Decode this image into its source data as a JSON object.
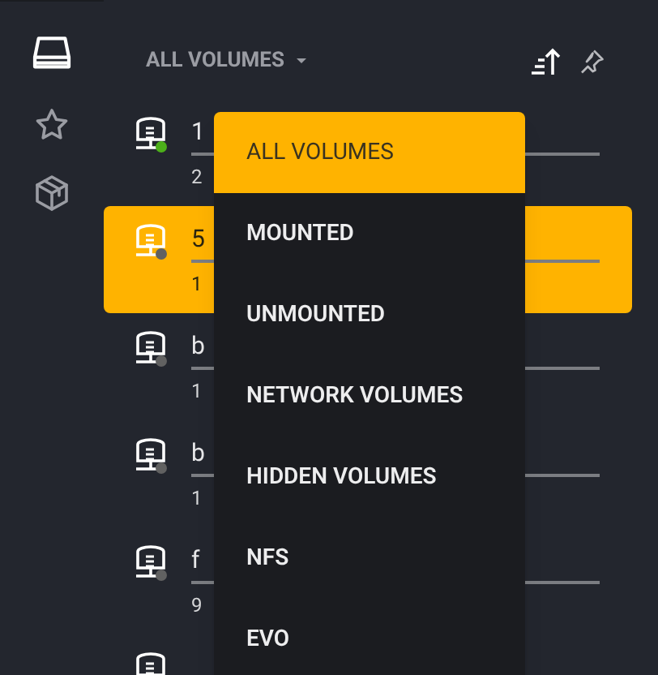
{
  "rail": [
    {
      "kind": "drive",
      "selected": true
    },
    {
      "kind": "star",
      "selected": false
    },
    {
      "kind": "box",
      "selected": false
    }
  ],
  "filter": {
    "label": "ALL VOLUMES"
  },
  "volumes": [
    {
      "name": "1",
      "detail": "2",
      "color": "#4caf1a",
      "selected": false
    },
    {
      "name": "5",
      "detail": "1",
      "color": "#616161",
      "selected": true
    },
    {
      "name": "b",
      "detail": "1",
      "color": "#616161",
      "selected": false
    },
    {
      "name": "b",
      "detail": "1",
      "color": "#616161",
      "selected": false
    },
    {
      "name": "f",
      "detail": "9",
      "color": "#616161",
      "selected": false
    },
    {
      "selected": false
    }
  ],
  "menu": [
    {
      "label": "ALL VOLUMES",
      "selected": true
    },
    {
      "label": "MOUNTED",
      "selected": false
    },
    {
      "label": "UNMOUNTED",
      "selected": false
    },
    {
      "label": "NETWORK VOLUMES",
      "selected": false
    },
    {
      "label": "HIDDEN VOLUMES",
      "selected": false
    },
    {
      "label": "NFS",
      "selected": false
    },
    {
      "label": "EVO",
      "selected": false
    }
  ]
}
